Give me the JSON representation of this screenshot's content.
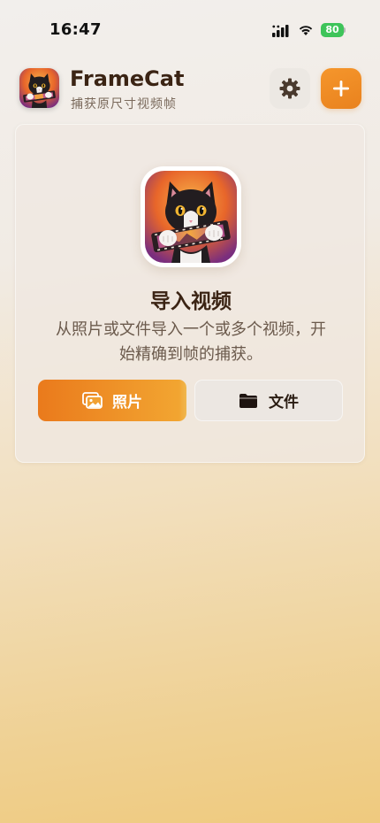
{
  "status_bar": {
    "time": "16:47",
    "battery": "80"
  },
  "header": {
    "title": "FrameCat",
    "subtitle": "捕获原尺寸视频帧",
    "settings_icon": "gear-icon",
    "add_icon": "plus-icon"
  },
  "import_card": {
    "title": "导入视频",
    "description": "从照片或文件导入一个或多个视频，开始精确到帧的捕获。",
    "photos_label": "照片",
    "photos_icon": "photos-icon",
    "files_label": "文件",
    "files_icon": "folder-icon"
  },
  "colors": {
    "accent": "#f0902a",
    "title_text": "#3b2414",
    "battery": "#3ec45a"
  }
}
